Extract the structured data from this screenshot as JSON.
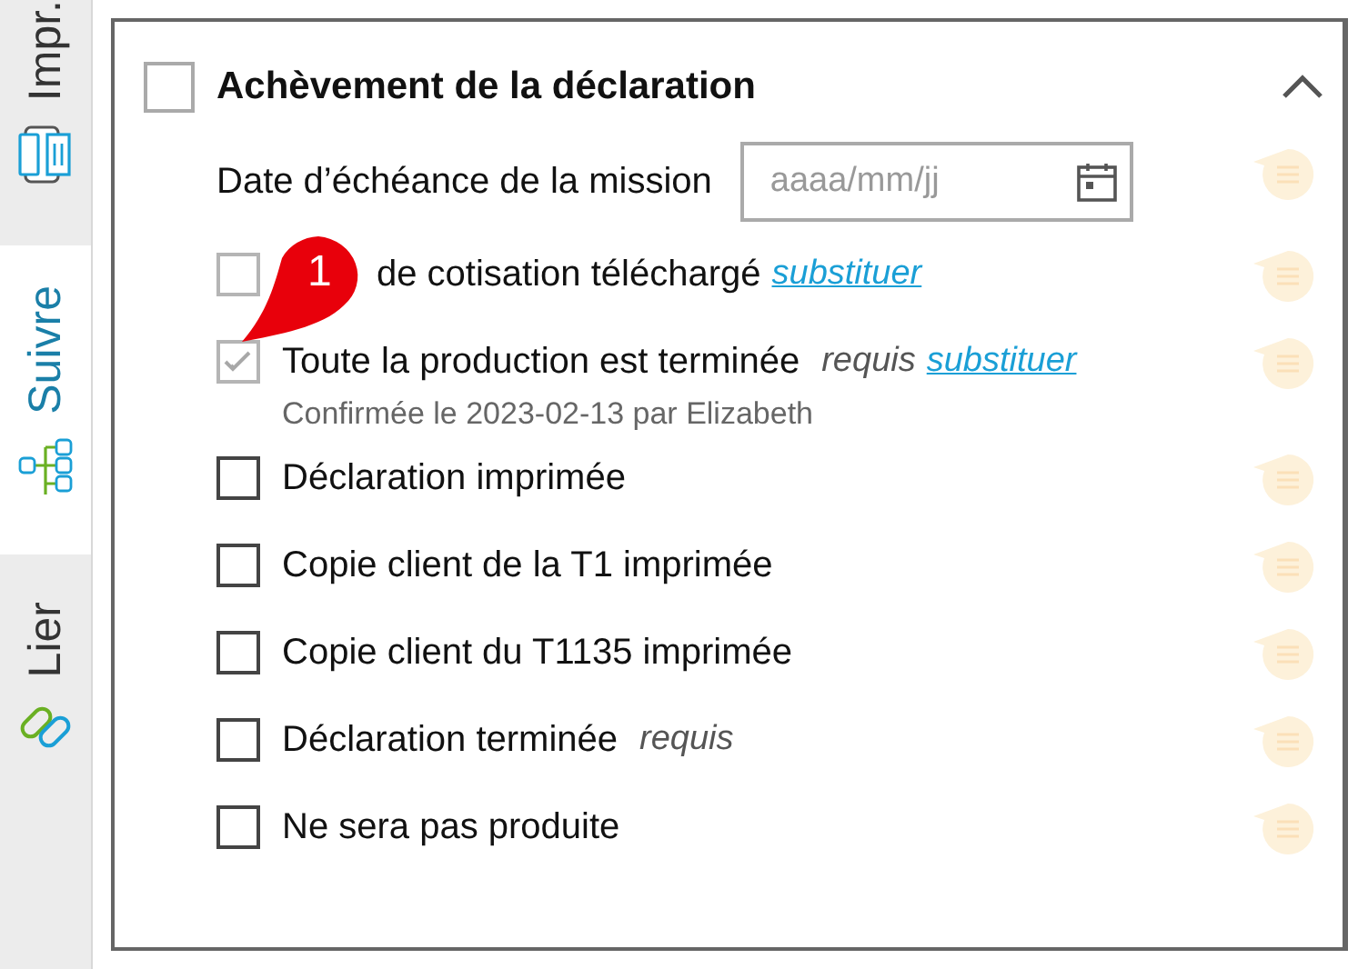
{
  "side_tabs": [
    {
      "label": "Impr.",
      "kind": "print",
      "selected": false
    },
    {
      "label": "Suivre",
      "kind": "track",
      "selected": true
    },
    {
      "label": "Lier",
      "kind": "link",
      "selected": false
    }
  ],
  "section": {
    "title": "Achèvement de la déclaration",
    "checked": false,
    "expanded": true
  },
  "items": [
    {
      "kind": "date",
      "label": "Date d’échéance de la mission",
      "placeholder": "aaaa/mm/jj"
    },
    {
      "kind": "check",
      "label": "de cotisation téléchargé",
      "checked": false,
      "disabled": true,
      "link": "substituer"
    },
    {
      "kind": "check",
      "label": "Toute la production est terminée",
      "checked": true,
      "disabled": true,
      "required": "requis",
      "link": "substituer",
      "note": "Confirmée le 2023-02-13 par Elizabeth"
    },
    {
      "kind": "check",
      "label": "Déclaration imprimée",
      "checked": false,
      "disabled": false
    },
    {
      "kind": "check",
      "label": "Copie client de la T1 imprimée",
      "checked": false,
      "disabled": false
    },
    {
      "kind": "check",
      "label": "Copie client du T1135 imprimée",
      "checked": false,
      "disabled": false
    },
    {
      "kind": "check",
      "label": "Déclaration terminée",
      "checked": false,
      "disabled": false,
      "required": "requis"
    },
    {
      "kind": "check",
      "label": "Ne sera pas produite",
      "checked": false,
      "disabled": false
    }
  ],
  "callout": {
    "number": "1"
  }
}
